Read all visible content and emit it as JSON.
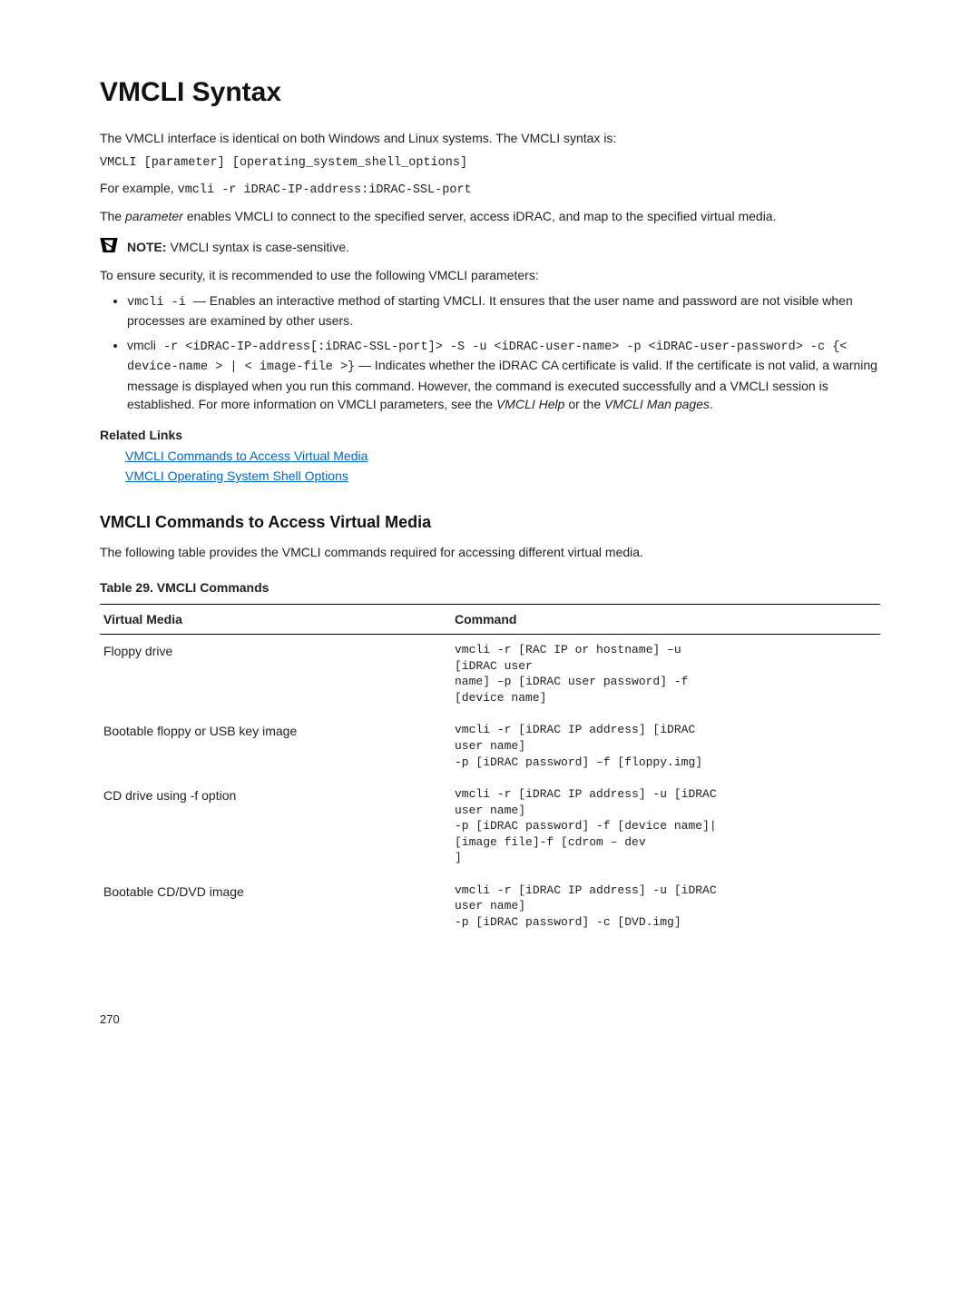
{
  "heading": "VMCLI Syntax",
  "intro": "The VMCLI interface is identical on both Windows and Linux systems. The VMCLI syntax is:",
  "syntax_line": "VMCLI [parameter] [operating_system_shell_options]",
  "example_prefix": "For example, ",
  "example_cmd": "vmcli -r iDRAC-IP-address:iDRAC-SSL-port",
  "parameter_para_1": "The ",
  "parameter_word": "parameter",
  "parameter_para_2": " enables VMCLI to connect to the specified server, access iDRAC, and map to the specified virtual media.",
  "note_label": "NOTE: ",
  "note_text": "VMCLI syntax is case-sensitive.",
  "security_line": "To ensure security, it is recommended to use the following VMCLI parameters:",
  "bullet1_cmd": "vmcli -i ",
  "bullet1_rest": " — Enables an interactive method of starting VMCLI. It ensures that the user name and password are not visible when processes are examined by other users.",
  "bullet2_pre": "vmcli",
  "bullet2_cmd": " -r <iDRAC-IP-address[:iDRAC-SSL-port]> -S -u <iDRAC-user-name> -p <iDRAC-user-password> -c {< device-name > | < image-file >}",
  "bullet2_rest_1": " — Indicates whether the iDRAC CA certificate is valid. If the certificate is not valid, a warning message is displayed when you run this command. However, the command is executed successfully and a VMCLI session is established. For more information on VMCLI parameters, see the ",
  "bullet2_italic1": "VMCLI Help",
  "bullet2_mid": " or the ",
  "bullet2_italic2": "VMCLI Man pages",
  "bullet2_end": ".",
  "related_links_label": "Related Links",
  "link1": "VMCLI Commands to Access Virtual Media",
  "link2": "VMCLI Operating System Shell Options",
  "sub_heading": "VMCLI Commands to Access Virtual Media",
  "sub_intro": "The following table provides the VMCLI commands required for accessing different virtual media.",
  "table_caption": "Table 29. VMCLI Commands",
  "th_media": "Virtual Media",
  "th_command": "Command",
  "rows": [
    {
      "media": "Floppy drive",
      "cmd": "vmcli -r [RAC IP or hostname] –u\n[iDRAC user\nname] –p [iDRAC user password] -f\n[device name]"
    },
    {
      "media": "Bootable floppy or USB key image",
      "cmd": "vmcli -r [iDRAC IP address] [iDRAC\nuser name]\n-p [iDRAC password] –f [floppy.img]"
    },
    {
      "media": "CD drive using -f option",
      "cmd": "vmcli -r [iDRAC IP address] -u [iDRAC\nuser name]\n-p [iDRAC password] -f [device name]|\n[image file]-f [cdrom – dev\n]"
    },
    {
      "media": "Bootable CD/DVD image",
      "cmd": "vmcli -r [iDRAC IP address] -u [iDRAC\nuser name]\n-p [iDRAC password] -c [DVD.img]"
    }
  ],
  "page_number": "270"
}
